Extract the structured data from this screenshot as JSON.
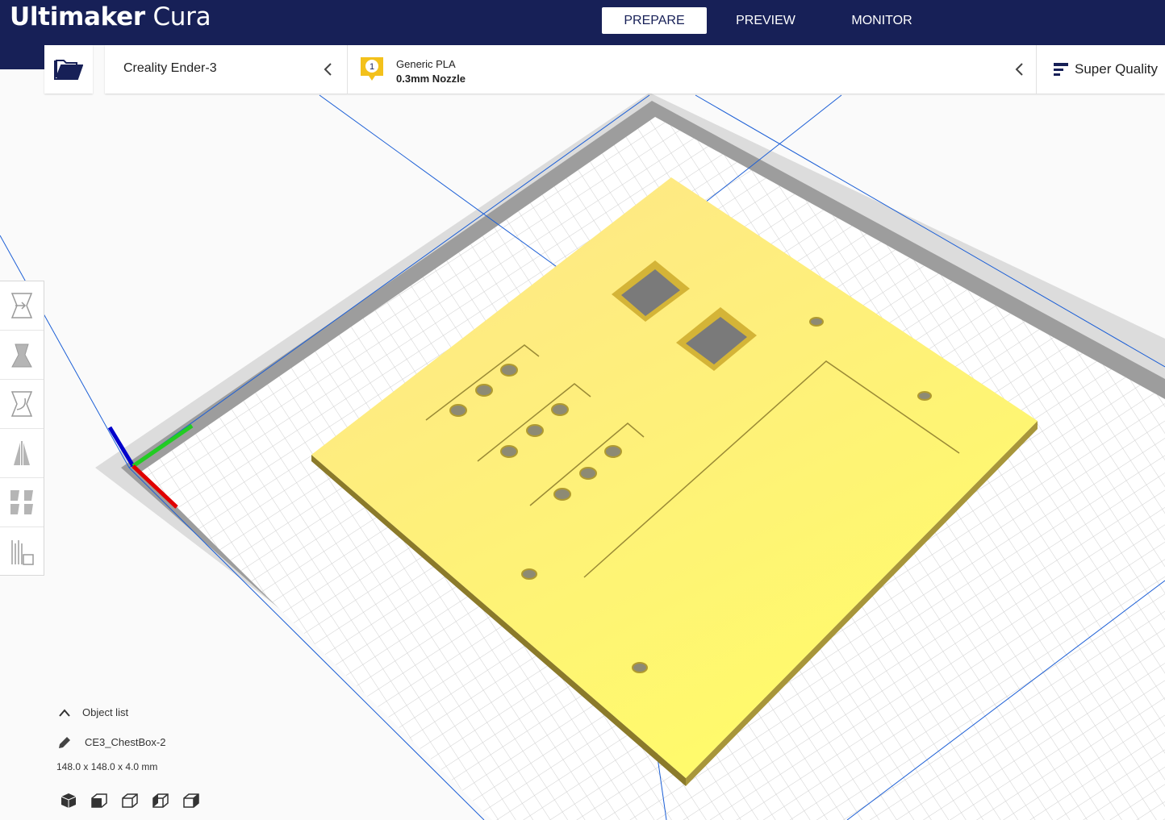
{
  "app": {
    "brand_bold": "Ultimaker",
    "brand_light": "Cura"
  },
  "stages": [
    "PREPARE",
    "PREVIEW",
    "MONITOR"
  ],
  "printer": {
    "name": "Creality Ender-3"
  },
  "material": {
    "extruder_number": "1",
    "name": "Generic PLA",
    "nozzle": "0.3mm Nozzle",
    "badge_color": "#f3c11b"
  },
  "quality": {
    "label": "Super Quality"
  },
  "object_list": {
    "toggle_label": "Object list",
    "object_name": "CE3_ChestBox-2",
    "dimensions": "148.0 x 148.0 x 4.0 mm"
  },
  "tools": [
    "move-tool-icon",
    "scale-tool-icon",
    "rotate-tool-icon",
    "mirror-tool-icon",
    "per-model-settings-icon",
    "support-blocker-icon"
  ],
  "camera_views": [
    "3d-view-icon",
    "front-view-icon",
    "top-view-icon",
    "left-view-icon",
    "right-view-icon"
  ],
  "colors": {
    "header": "#172057",
    "model": "#fff66a",
    "build_plate": "#ffffff",
    "axis_x": "#e00000",
    "axis_y": "#22cc22",
    "axis_z": "#0000cc"
  }
}
